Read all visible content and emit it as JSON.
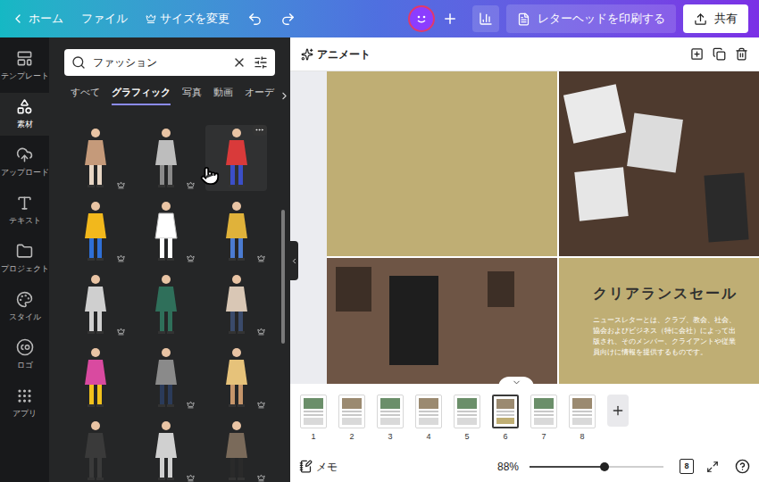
{
  "topbar": {
    "home": "ホーム",
    "file": "ファイル",
    "resize": "サイズを変更",
    "print": "レターヘッドを印刷する",
    "share": "共有"
  },
  "rail": [
    {
      "label": "テンプレート",
      "selected": false
    },
    {
      "label": "素材",
      "selected": true
    },
    {
      "label": "アップロード",
      "selected": false
    },
    {
      "label": "テキスト",
      "selected": false
    },
    {
      "label": "プロジェクト",
      "selected": false
    },
    {
      "label": "スタイル",
      "selected": false
    },
    {
      "label": "ロゴ",
      "selected": false
    },
    {
      "label": "アプリ",
      "selected": false
    }
  ],
  "search": {
    "value": "ファッション"
  },
  "filter_tabs": [
    {
      "label": "すべて",
      "selected": false
    },
    {
      "label": "グラフィック",
      "selected": true
    },
    {
      "label": "写真",
      "selected": false
    },
    {
      "label": "動画",
      "selected": false
    },
    {
      "label": "オーデ",
      "selected": false
    }
  ],
  "graphics": [
    {
      "premium": true,
      "hovered": false
    },
    {
      "premium": true,
      "hovered": false
    },
    {
      "premium": false,
      "hovered": true
    },
    {
      "premium": true,
      "hovered": false
    },
    {
      "premium": true,
      "hovered": false
    },
    {
      "premium": true,
      "hovered": false
    },
    {
      "premium": true,
      "hovered": false
    },
    {
      "premium": false,
      "hovered": false
    },
    {
      "premium": true,
      "hovered": false
    },
    {
      "premium": false,
      "hovered": false
    },
    {
      "premium": true,
      "hovered": false
    },
    {
      "premium": true,
      "hovered": false
    },
    {
      "premium": false,
      "hovered": false
    },
    {
      "premium": true,
      "hovered": false
    },
    {
      "premium": true,
      "hovered": false
    }
  ],
  "toolbar": {
    "animate": "アニメート"
  },
  "page": {
    "title": "クリアランスセール",
    "body_lines": [
      "ニュースレターとは、クラブ、教会、社会、",
      "協会およびビジネス（特に会社）によって出",
      "版され、そのメンバー、クライアントや従業",
      "員向けに情報を提供するものです。"
    ]
  },
  "pages": [
    {
      "number": "1",
      "selected": false
    },
    {
      "number": "2",
      "selected": false
    },
    {
      "number": "3",
      "selected": false
    },
    {
      "number": "4",
      "selected": false
    },
    {
      "number": "5",
      "selected": false
    },
    {
      "number": "6",
      "selected": true
    },
    {
      "number": "7",
      "selected": false
    },
    {
      "number": "8",
      "selected": false
    }
  ],
  "bottom": {
    "notes": "メモ",
    "zoom": "88%",
    "zoom_level": 0.56,
    "page_count": "8"
  }
}
